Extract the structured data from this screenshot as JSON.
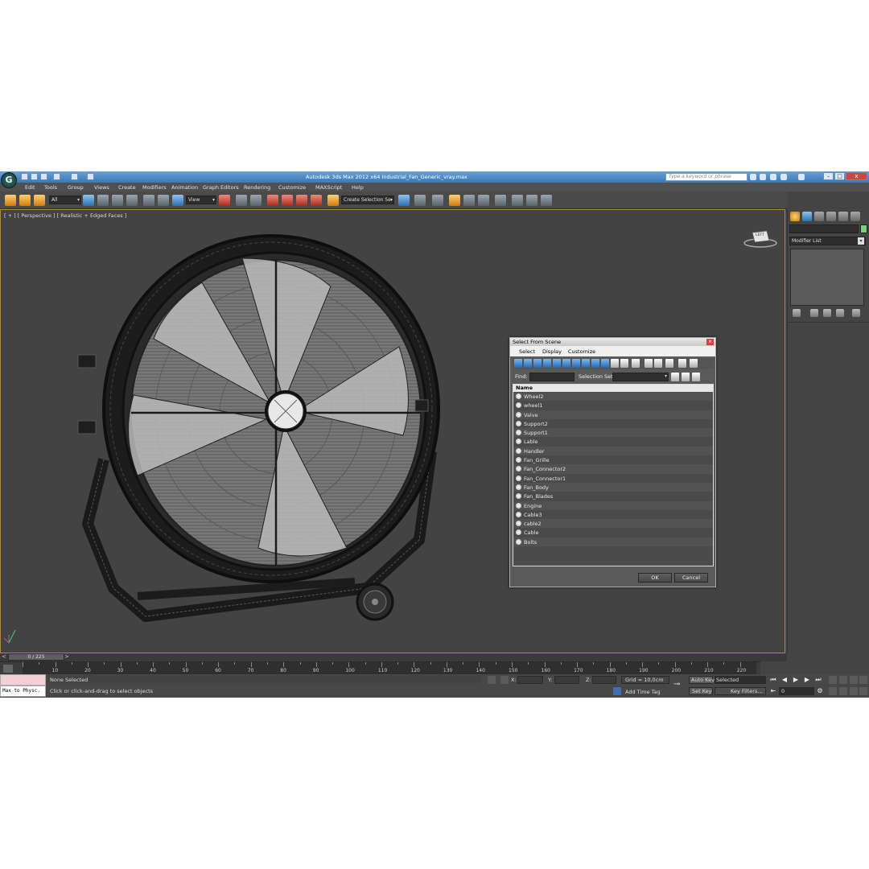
{
  "window": {
    "title": "Autodesk 3ds Max  2012 x64      Industrial_Fan_Generic_vray.max",
    "search_placeholder": "Type a keyword or phrase"
  },
  "menu": [
    "Edit",
    "Tools",
    "Group",
    "Views",
    "Create",
    "Modifiers",
    "Animation",
    "Graph Editors",
    "Rendering",
    "Customize",
    "MAXScript",
    "Help"
  ],
  "toolbar": {
    "selection_filter": "All",
    "reference_coord": "View",
    "named_selection": "Create Selection Se"
  },
  "viewport": {
    "label": "[ + ] [ Perspective ] [ Realistic + Edged Faces ]",
    "viewcube_label": "LEFT"
  },
  "command_panel": {
    "modifier_list": "Modifier List"
  },
  "dialog": {
    "title": "Select From Scene",
    "close": "x",
    "menus": [
      "Select",
      "Display",
      "Customize"
    ],
    "find_label": "Find:",
    "selection_set_label": "Selection Set:",
    "column_header": "Name",
    "items": [
      "Wheel2",
      "wheel1",
      "Valve",
      "Support2",
      "Support1",
      "Lable",
      "Handler",
      "Fan_Grille",
      "Fan_Connector2",
      "Fan_Connector1",
      "Fan_Body",
      "Fan_Blades",
      "Engine",
      "Cable3",
      "cable2",
      "Cable",
      "Bolts"
    ],
    "ok": "OK",
    "cancel": "Cancel"
  },
  "timeline": {
    "slider_label": "0 / 225",
    "ticks": [
      10,
      20,
      30,
      40,
      50,
      60,
      70,
      80,
      90,
      100,
      110,
      120,
      130,
      140,
      150,
      160,
      170,
      180,
      190,
      200,
      210,
      220
    ]
  },
  "status": {
    "maxscript_text": "Max to Physc.",
    "selection": "None Selected",
    "prompt": "Click or click-and-drag to select objects",
    "x_label": "X:",
    "y_label": "Y:",
    "z_label": "Z:",
    "grid": "Grid = 10,0cm",
    "add_time_tag": "Add Time Tag",
    "auto_key": "Auto Key",
    "set_key": "Set Key",
    "key_mode": "Selected",
    "key_filters": "Key Filters...",
    "frame": "0"
  }
}
